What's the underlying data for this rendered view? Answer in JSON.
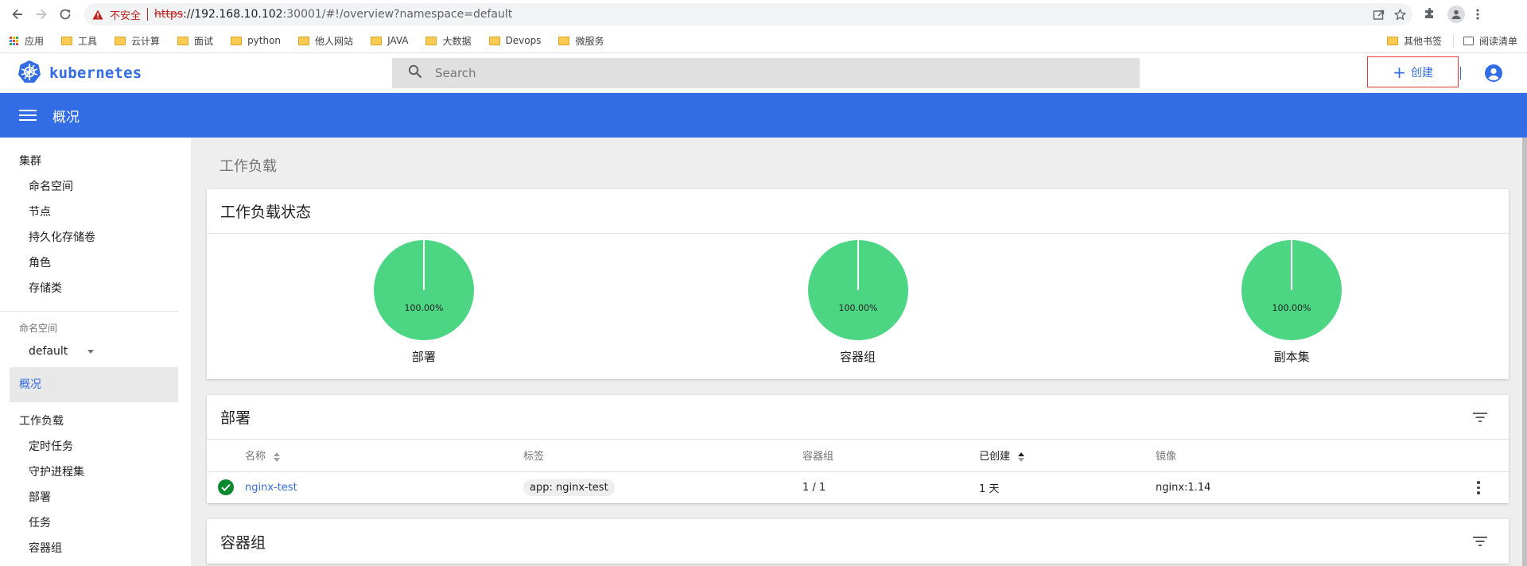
{
  "browser": {
    "insecure_label": "不安全",
    "url_scheme": "https",
    "url_host": "://192.168.10.102",
    "url_rest": ":30001/#!/overview?namespace=default",
    "bookmarks": [
      "应用",
      "工具",
      "云计算",
      "面试",
      "python",
      "他人网站",
      "JAVA",
      "大数据",
      "Devops",
      "微服务"
    ],
    "other_bookmarks": "其他书签",
    "reading_list": "阅读清单"
  },
  "header": {
    "brand": "kubernetes",
    "search_placeholder": "Search",
    "create_label": "创建"
  },
  "toolbar": {
    "title": "概况"
  },
  "sidebar": {
    "cluster_heading": "集群",
    "cluster_items": [
      "命名空间",
      "节点",
      "持久化存储卷",
      "角色",
      "存储类"
    ],
    "namespace_label": "命名空间",
    "namespace_value": "default",
    "active_item": "概况",
    "workloads_heading": "工作负载",
    "workload_items": [
      "定时任务",
      "守护进程集",
      "部署",
      "任务",
      "容器组"
    ]
  },
  "main": {
    "section_title": "工作负载",
    "status_card": {
      "title": "工作负载状态",
      "pies": [
        {
          "label": "部署",
          "percent_text": "100.00%",
          "value": 100
        },
        {
          "label": "容器组",
          "percent_text": "100.00%",
          "value": 100
        },
        {
          "label": "副本集",
          "percent_text": "100.00%",
          "value": 100
        }
      ]
    },
    "deploy_card": {
      "title": "部署",
      "columns": [
        "名称",
        "标签",
        "容器组",
        "已创建",
        "镜像"
      ],
      "rows": [
        {
          "name": "nginx-test",
          "label": "app: nginx-test",
          "pods": "1 / 1",
          "created": "1 天",
          "image": "nginx:1.14"
        }
      ]
    },
    "pods_card": {
      "title": "容器组"
    }
  },
  "colors": {
    "accent": "#326de6",
    "pie_green": "#4cd684",
    "status_ok": "#0a8a2e",
    "warning_red": "#c5221f"
  }
}
